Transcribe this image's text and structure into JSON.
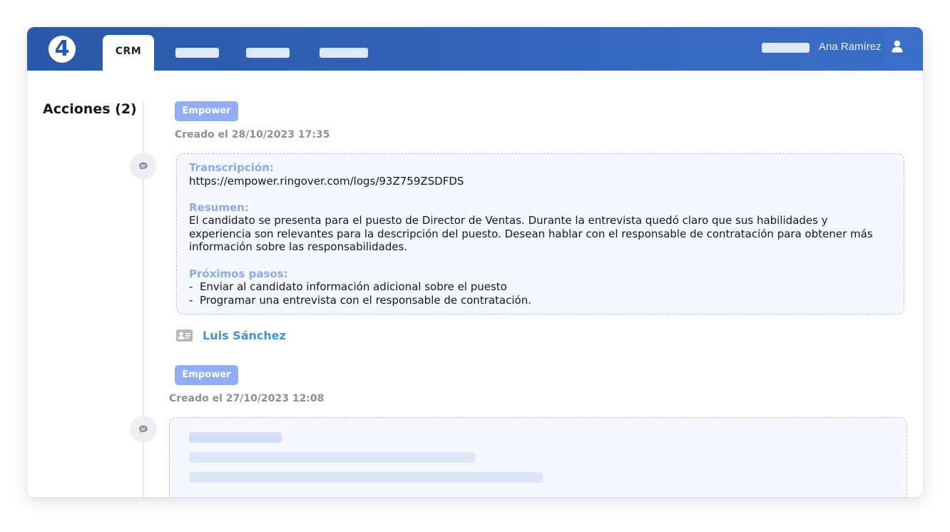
{
  "header": {
    "logo_text": "4",
    "tabs": [
      {
        "label": "CRM",
        "active": true
      }
    ],
    "username": "Ana Ramírez",
    "icons": {
      "user": "user-icon"
    }
  },
  "colors": {
    "header": "#2b58a8",
    "badge": "#8faef7",
    "heading": "#8ba9ee",
    "link": "#3f91d8"
  },
  "actions": {
    "title": "Acciones (2)",
    "items": [
      {
        "badge": "Empower",
        "created": "Creado el 28/10/2023 17:35",
        "icon": "chat-bubble-icon",
        "transcription_label": "Transcripción:",
        "transcription_link": "https://empower.ringover.com/logs/93Z759ZSDFDS",
        "summary_label": "Resumen:",
        "summary_text": "El candidato se presenta para el puesto de Director de Ventas. Durante la entrevista quedó claro que sus habilidades y experiencia son relevantes para la descripción del puesto. Desean hablar con el responsable de contratación para obtener más información sobre las responsabilidades.",
        "next_steps_label": "Próximos pasos:",
        "next_steps": [
          "-  Enviar al candidato información adicional sobre el puesto",
          "-  Programar una entrevista con el responsable de contratación."
        ],
        "contact": "Luis Sánchez",
        "contact_icon": "contact-card-icon"
      },
      {
        "badge": "Empower",
        "created": "Creado el 27/10/2023 12:08",
        "icon": "chat-bubble-icon"
      }
    ]
  }
}
